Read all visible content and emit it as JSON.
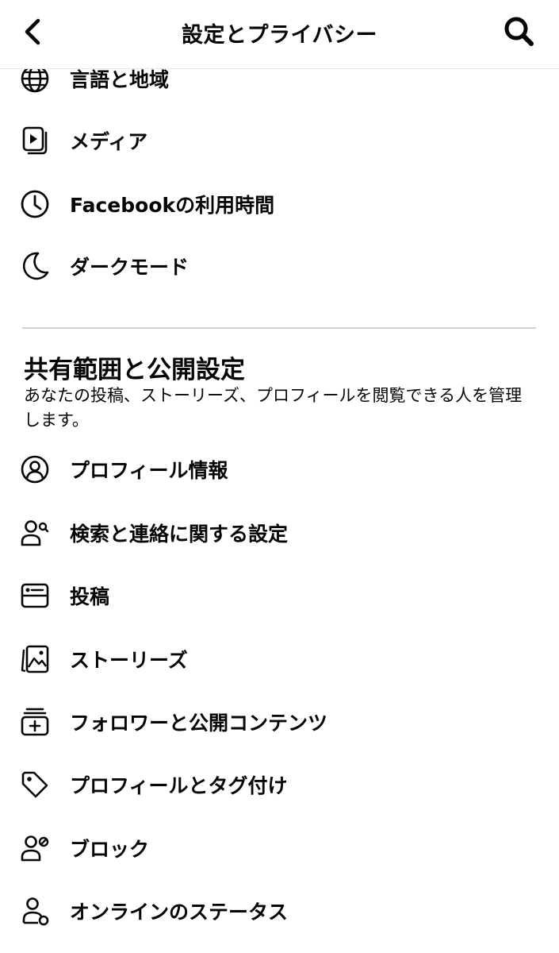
{
  "header": {
    "title": "設定とプライバシー"
  },
  "top_items": [
    {
      "label": "言語と地域",
      "icon": "globe-icon"
    },
    {
      "label": "メディア",
      "icon": "media-icon"
    },
    {
      "label": "Facebookの利用時間",
      "icon": "clock-icon"
    },
    {
      "label": "ダークモード",
      "icon": "moon-icon"
    }
  ],
  "section": {
    "title": "共有範囲と公開設定",
    "description": "あなたの投稿、ストーリーズ、プロフィールを閲覧できる人を管理します。"
  },
  "section_items": [
    {
      "label": "プロフィール情報",
      "icon": "profile-circle-icon"
    },
    {
      "label": "検索と連絡に関する設定",
      "icon": "person-search-icon"
    },
    {
      "label": "投稿",
      "icon": "post-icon"
    },
    {
      "label": "ストーリーズ",
      "icon": "stories-icon"
    },
    {
      "label": "フォロワーと公開コンテンツ",
      "icon": "followers-icon"
    },
    {
      "label": "プロフィールとタグ付け",
      "icon": "tag-icon"
    },
    {
      "label": "ブロック",
      "icon": "block-person-icon"
    },
    {
      "label": "オンラインのステータス",
      "icon": "online-status-icon"
    }
  ]
}
